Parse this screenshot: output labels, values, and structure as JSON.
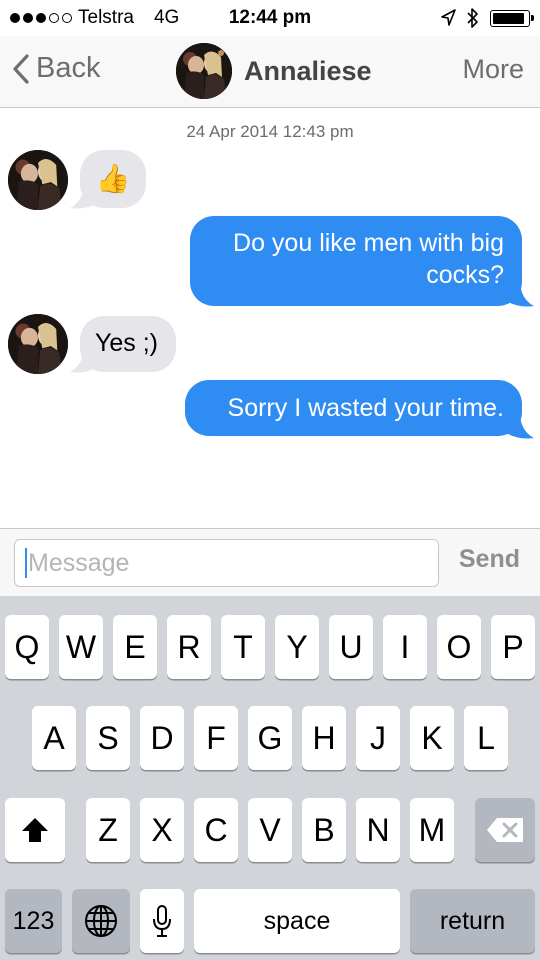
{
  "status_bar": {
    "carrier": "Telstra",
    "network": "4G",
    "time": "12:44 pm",
    "battery_level": 0.9,
    "signal_bars_filled": 3,
    "signal_bars_total": 5
  },
  "nav": {
    "back_label": "Back",
    "title": "Annaliese",
    "more_label": "More"
  },
  "conversation": {
    "timestamp": "24 Apr 2014 12:43 pm",
    "messages": [
      {
        "direction": "incoming",
        "text": "👍"
      },
      {
        "direction": "outgoing",
        "line1": "Do you like men with big",
        "line2": "cocks?"
      },
      {
        "direction": "incoming",
        "text": "Yes ;)"
      },
      {
        "direction": "outgoing",
        "text": "Sorry I wasted your time."
      }
    ]
  },
  "composer": {
    "placeholder": "Message",
    "send_label": "Send"
  },
  "keyboard": {
    "row1": [
      "Q",
      "W",
      "E",
      "R",
      "T",
      "Y",
      "U",
      "I",
      "O",
      "P"
    ],
    "row2": [
      "A",
      "S",
      "D",
      "F",
      "G",
      "H",
      "J",
      "K",
      "L"
    ],
    "row3": [
      "Z",
      "X",
      "C",
      "V",
      "B",
      "N",
      "M"
    ],
    "numbers_label": "123",
    "space_label": "space",
    "return_label": "return"
  },
  "colors": {
    "outgoing_bubble": "#2f8cf2",
    "incoming_bubble": "#e5e5ea",
    "keyboard_bg": "#d1d4d9"
  },
  "icons": [
    "back-chevron-icon",
    "location-arrow-icon",
    "bluetooth-icon",
    "battery-icon",
    "shift-icon",
    "backspace-icon",
    "globe-icon",
    "microphone-icon"
  ]
}
